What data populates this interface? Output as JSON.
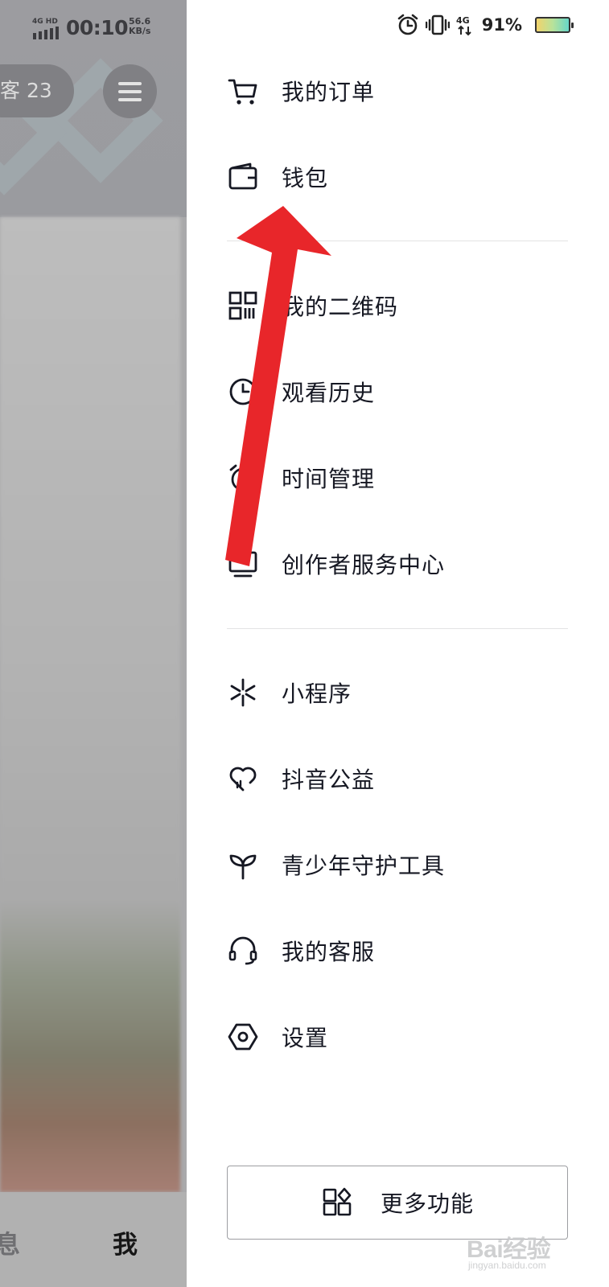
{
  "background": {
    "status": {
      "network": "4G HD",
      "time": "00:10",
      "speed_value": "56.6",
      "speed_unit": "KB/s"
    },
    "visitor_chip": "客 23",
    "tabbar": {
      "messages_partial": "息",
      "me": "我"
    }
  },
  "status_bar": {
    "battery": "91%",
    "icons": [
      "alarm-icon",
      "vibrate-icon",
      "4g-icon"
    ]
  },
  "menu": {
    "section1": [
      {
        "label": "我的订单",
        "icon": "cart-icon"
      },
      {
        "label": "钱包",
        "icon": "wallet-icon"
      }
    ],
    "section2": [
      {
        "label": "我的二维码",
        "icon": "qr-code-icon"
      },
      {
        "label": "观看历史",
        "icon": "clock-icon"
      },
      {
        "label": "时间管理",
        "icon": "alarm-clock-icon"
      },
      {
        "label": "创作者服务中心",
        "icon": "monitor-icon"
      }
    ],
    "section3": [
      {
        "label": "小程序",
        "icon": "mini-program-icon"
      },
      {
        "label": "抖音公益",
        "icon": "heart-icon"
      },
      {
        "label": "青少年守护工具",
        "icon": "sprout-icon"
      },
      {
        "label": "我的客服",
        "icon": "headset-icon"
      },
      {
        "label": "设置",
        "icon": "settings-hexagon-icon"
      }
    ]
  },
  "more_button": {
    "label": "更多功能",
    "icon": "grid-icon"
  },
  "annotation": {
    "type": "red-arrow",
    "color": "#e8262a",
    "points_to": "钱包"
  },
  "watermark": {
    "text": "Bai经验",
    "url": "jingyan.baidu.com"
  }
}
